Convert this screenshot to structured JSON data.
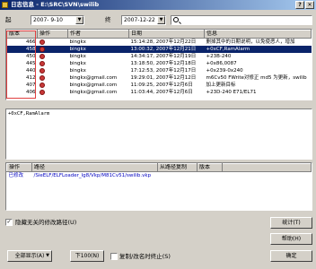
{
  "window": {
    "title": "日志信息 - E:\\SRC\\SVN\\swilib"
  },
  "filter": {
    "from_label": "起",
    "from_date": "2007- 9-10",
    "to_label": "终",
    "to_date": "2007-12-22",
    "search_placeholder": ""
  },
  "log_table": {
    "columns": [
      "版本",
      "操作",
      "作者",
      "日期",
      "信息"
    ],
    "rows": [
      {
        "rev": "466",
        "author": "bingkx",
        "date": "15:14:28, 2007年12月22日",
        "msg": "删掉其中的日期说明，以免使恶人，增加"
      },
      {
        "rev": "458",
        "author": "bingkx",
        "date": "13:00:32, 2007年12月21日",
        "msg": "+0xCF,RamAlarm"
      },
      {
        "rev": "450",
        "author": "bingkx",
        "date": "14:34:17, 2007年12月19日",
        "msg": "+23B-240"
      },
      {
        "rev": "445",
        "author": "bingkx",
        "date": "13:18:50, 2007年12月18日",
        "msg": "+0x86,0087"
      },
      {
        "rev": "440",
        "author": "bingkx",
        "date": "17:12:53, 2007年12月17日",
        "msg": "+0x239-0x240"
      },
      {
        "rev": "412",
        "author": "bingkx@gmail.com",
        "date": "19:29:01, 2007年12月12日",
        "msg": "m6Cv50 FWrite对修正 md5 为更新，swilib"
      },
      {
        "rev": "407",
        "author": "bingkx@gmail.com",
        "date": "11:09:25, 2007年12月6日",
        "msg": "加上更新目标"
      },
      {
        "rev": "406",
        "author": "bingkx@gmail.com",
        "date": "11:03:44, 2007年12月6日",
        "msg": "+23D-240 E71/EL71"
      }
    ],
    "selected_index": 1
  },
  "message": {
    "text": "+0xCF,RamAlarm"
  },
  "paths_table": {
    "columns": [
      "操作",
      "路径",
      "从路径复制",
      "版本"
    ],
    "rows": [
      {
        "action": "已修改",
        "path": "/SieELF/ELFLoader_lg8/Vkp/M81Cv51/swilib.vkp",
        "copy_from": "",
        "rev": ""
      }
    ]
  },
  "options": {
    "hide_unrelated_label": "隐藏无关的修改路径(U)",
    "hide_unrelated_checked": true,
    "stop_on_copy_label": "复制/改名时终止(S)",
    "stop_on_copy_checked": false
  },
  "buttons": {
    "stats": "统计(T)",
    "help": "帮助(H)",
    "show_all": "全部显示(A)",
    "next_100": "下100(N)",
    "ok": "确定"
  }
}
